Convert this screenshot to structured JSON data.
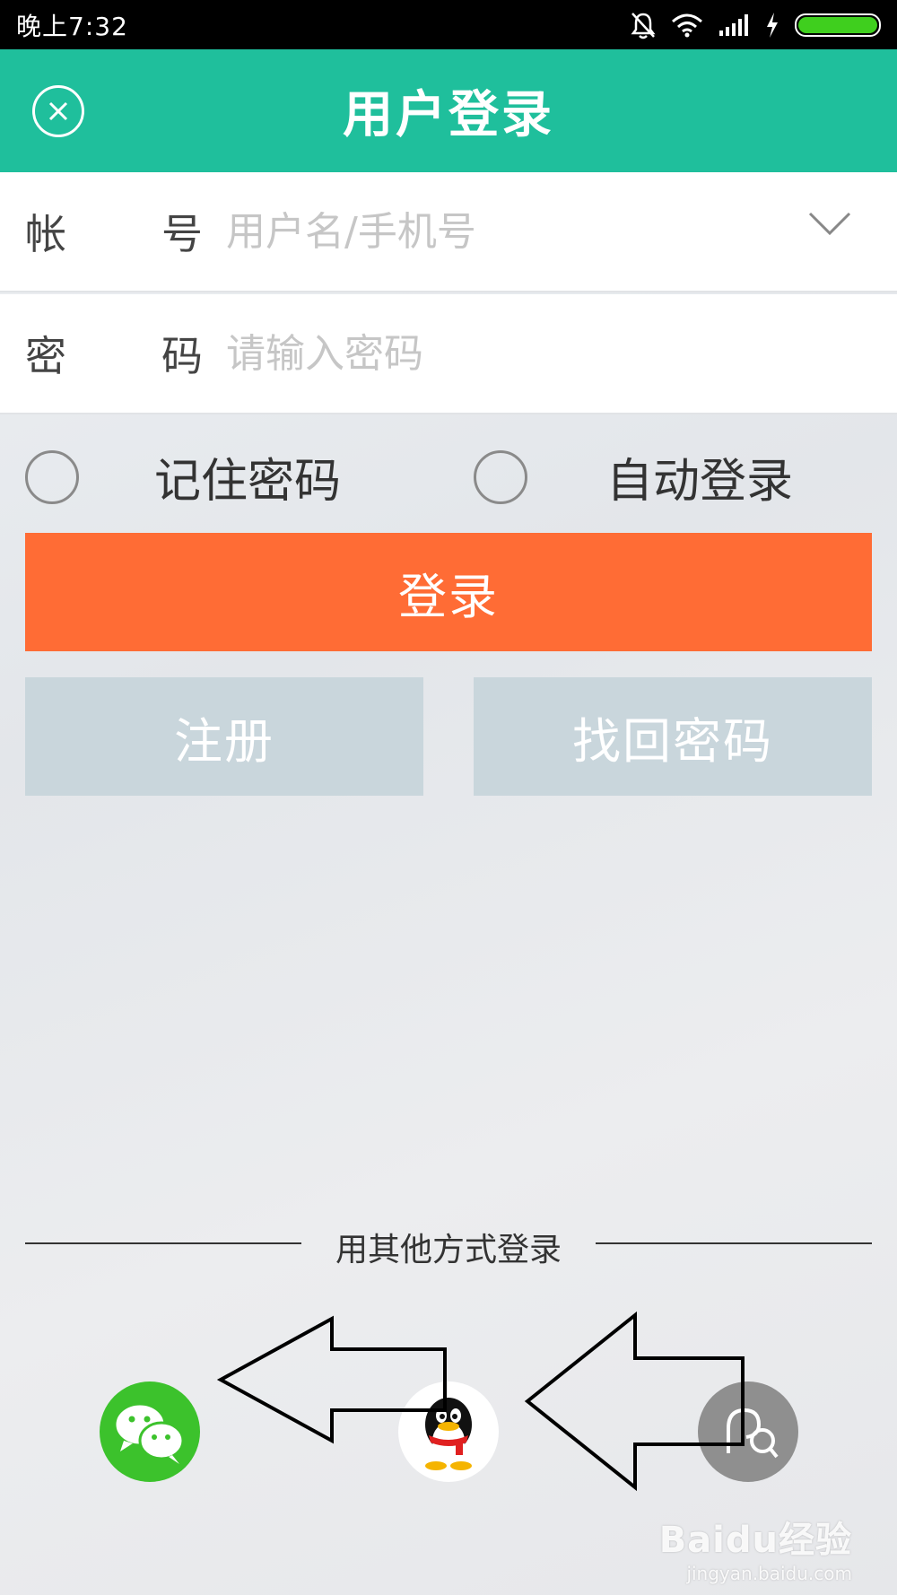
{
  "status_bar": {
    "time": "晚上7:32",
    "icons": [
      "bell-muted-icon",
      "wifi-icon",
      "signal-icon",
      "charging-icon",
      "battery-icon"
    ],
    "battery_color": "#3fcf1e"
  },
  "header": {
    "title": "用户登录",
    "close_icon": "close-circle-icon",
    "background": "#1fbf9c"
  },
  "form": {
    "account": {
      "label_a": "帐",
      "label_b": "号",
      "placeholder": "用户名/手机号",
      "value": "",
      "dropdown_icon": "chevron-down-icon"
    },
    "password": {
      "label_a": "密",
      "label_b": "码",
      "placeholder": "请输入密码",
      "value": ""
    }
  },
  "options": {
    "remember_password": {
      "label": "记住密码",
      "checked": false
    },
    "auto_login": {
      "label": "自动登录",
      "checked": false
    }
  },
  "buttons": {
    "login": "登录",
    "register": "注册",
    "find_password": "找回密码",
    "login_color": "#ff6c35",
    "secondary_color": "#c9d6dc"
  },
  "other_login": {
    "divider_text": "用其他方式登录",
    "providers": [
      "wechat-icon",
      "qq-icon",
      "weibo-icon"
    ]
  },
  "watermark": {
    "logo": "Baidu经验",
    "url": "jingyan.baidu.com"
  }
}
